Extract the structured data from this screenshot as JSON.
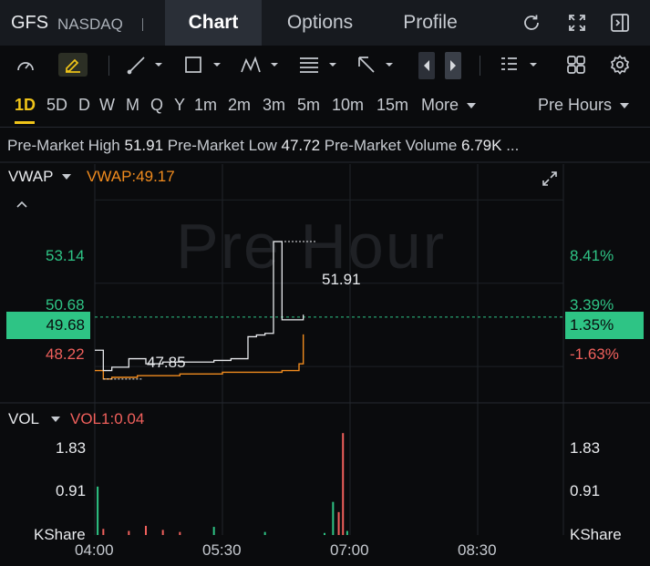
{
  "header": {
    "ticker": "GFS",
    "exchange": "NASDAQ",
    "tabs": [
      {
        "label": "Chart",
        "active": true
      },
      {
        "label": "Options",
        "active": false
      },
      {
        "label": "Profile",
        "active": false
      }
    ],
    "icons": [
      "refresh-icon",
      "fullscreen-icon",
      "collapse-panel-icon"
    ]
  },
  "toolbar": {
    "icons": [
      "gauge-icon",
      "pen-edit-icon",
      "trend-line-icon",
      "rectangle-icon",
      "pattern-icon",
      "fib-icon",
      "arrow-icon",
      "nav-left-icon",
      "nav-right-icon",
      "list-icon",
      "grid-icon",
      "settings-icon"
    ]
  },
  "timeframes": {
    "items": [
      "1D",
      "5D",
      "D",
      "W",
      "M",
      "Q",
      "Y",
      "1m",
      "2m",
      "3m",
      "5m",
      "10m",
      "15m"
    ],
    "active": "1D",
    "more_label": "More",
    "session_label": "Pre Hours"
  },
  "info": {
    "high_label": "Pre-Market High",
    "high_value": "51.91",
    "low_label": "Pre-Market Low",
    "low_value": "47.72",
    "volume_label": "Pre-Market Volume",
    "volume_value": "6.79K",
    "ellipsis": "..."
  },
  "price_pane": {
    "indicator_label": "VWAP",
    "vwap_readout": "VWAP:49.17",
    "watermark": "Pre Hour",
    "left_axis": [
      "53.14",
      "50.68",
      "48.22"
    ],
    "current_price": "49.68",
    "right_axis": [
      "8.41%",
      "3.39%",
      "-1.63%"
    ],
    "current_pct": "1.35%",
    "high_marker": "51.91",
    "low_marker": "47.85"
  },
  "volume_pane": {
    "indicator_label": "VOL",
    "vol_readout": "VOL1:0.04",
    "left_axis": [
      "1.83",
      "0.91",
      "KShare"
    ],
    "right_axis": [
      "1.83",
      "0.91",
      "KShare"
    ]
  },
  "x_axis": [
    "04:00",
    "05:30",
    "07:00",
    "08:30"
  ],
  "colors": {
    "up": "#2ec485",
    "down": "#f0605c",
    "vwap": "#f08b1e",
    "price_line": "#e8eaed",
    "accent": "#f0c419"
  },
  "chart_data": {
    "type": "line",
    "price_series": {
      "x": [
        "04:00",
        "04:06",
        "04:12",
        "04:24",
        "04:36",
        "04:48",
        "05:00",
        "05:12",
        "05:24",
        "05:36",
        "05:48",
        "05:54",
        "06:00",
        "06:06",
        "06:12",
        "06:18",
        "06:24",
        "06:27"
      ],
      "values": [
        48.7,
        48.1,
        48.2,
        48.45,
        48.3,
        48.35,
        48.35,
        48.35,
        48.4,
        48.45,
        49.1,
        49.15,
        49.2,
        51.91,
        49.6,
        49.6,
        49.6,
        49.75
      ]
    },
    "vwap_series": {
      "x": [
        "04:00",
        "04:06",
        "04:12",
        "04:30",
        "05:00",
        "05:30",
        "06:00",
        "06:12",
        "06:18",
        "06:24",
        "06:27"
      ],
      "values": [
        48.1,
        47.85,
        47.9,
        47.95,
        48.0,
        48.05,
        48.05,
        48.1,
        48.1,
        48.3,
        49.17
      ]
    },
    "volume_bars": [
      {
        "x": "04:02",
        "v": 0.95,
        "dir": "up"
      },
      {
        "x": "04:06",
        "v": 0.12,
        "dir": "down"
      },
      {
        "x": "04:24",
        "v": 0.08,
        "dir": "down"
      },
      {
        "x": "04:36",
        "v": 0.18,
        "dir": "down"
      },
      {
        "x": "04:48",
        "v": 0.1,
        "dir": "down"
      },
      {
        "x": "05:00",
        "v": 0.06,
        "dir": "down"
      },
      {
        "x": "05:24",
        "v": 0.16,
        "dir": "up"
      },
      {
        "x": "06:00",
        "v": 0.06,
        "dir": "up"
      },
      {
        "x": "06:42",
        "v": 0.04,
        "dir": "up"
      },
      {
        "x": "06:48",
        "v": 0.65,
        "dir": "up"
      },
      {
        "x": "06:52",
        "v": 0.45,
        "dir": "down"
      },
      {
        "x": "06:55",
        "v": 2.0,
        "dir": "down"
      },
      {
        "x": "06:58",
        "v": 0.08,
        "dir": "up"
      }
    ],
    "ylim_price": [
      47.2,
      54.2
    ],
    "ylim_volume": [
      0,
      2.2
    ],
    "x_ticks": [
      "04:00",
      "05:30",
      "07:00",
      "08:30"
    ]
  }
}
